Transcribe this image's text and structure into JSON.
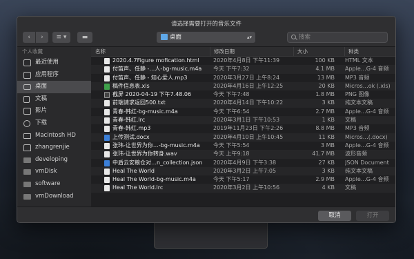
{
  "dialog": {
    "title": "请选择需要打开的音乐文件",
    "location": "桌面",
    "search_placeholder": "搜索"
  },
  "toolbar": {
    "back_glyph": "‹",
    "forward_glyph": "›",
    "view_glyph": "≡ ▾",
    "new_folder_glyph": "▬",
    "location_chevron": "▴▾"
  },
  "sidebar": {
    "heading": "个人收藏",
    "items": [
      {
        "label": "最近使用",
        "icon": "recent-icon"
      },
      {
        "label": "应用程序",
        "icon": "applications-icon"
      },
      {
        "label": "桌面",
        "icon": "desktop-icon"
      },
      {
        "label": "文稿",
        "icon": "documents-icon"
      },
      {
        "label": "影片",
        "icon": "movies-icon"
      },
      {
        "label": "下载",
        "icon": "downloads-icon"
      },
      {
        "label": "Macintosh HD",
        "icon": "hard-drive-icon"
      },
      {
        "label": "zhangrenjie",
        "icon": "home-icon"
      },
      {
        "label": "developing",
        "icon": "folder-icon"
      },
      {
        "label": "vmDisk",
        "icon": "folder-icon"
      },
      {
        "label": "software",
        "icon": "folder-icon"
      },
      {
        "label": "vmDownload",
        "icon": "folder-icon"
      }
    ]
  },
  "columns": {
    "name": "名称",
    "date": "修改日期",
    "size": "大小",
    "kind": "种类"
  },
  "files": [
    {
      "name": "2020.4.7Figure mofication.html",
      "date": "2020年4月8日 下午11:39",
      "size": "100 KB",
      "kind": "HTML 文本",
      "icon": "html-file-icon"
    },
    {
      "name": "付笛声、任静 -…人-bg-music.m4a",
      "date": "今天 下午7:32",
      "size": "4.1 MB",
      "kind": "Apple…G-4 音频",
      "icon": "audio-file-icon"
    },
    {
      "name": "付笛声、任静 - 知心爱人.mp3",
      "date": "2020年3月27日 上午8:24",
      "size": "13 MB",
      "kind": "MP3 音频",
      "icon": "audio-file-icon"
    },
    {
      "name": "稿件信息表.xls",
      "date": "2020年4月16日 上午12:25",
      "size": "20 KB",
      "kind": "Micros…ok (.xls)",
      "icon": "excel-file-icon"
    },
    {
      "name": "截屏 2020-04-19 下午7.48.06",
      "date": "今天 下午7:48",
      "size": "1.8 MB",
      "kind": "PNG 图像",
      "icon": "image-file-icon"
    },
    {
      "name": "前端请求返回500.txt",
      "date": "2020年4月14日 下午10:22",
      "size": "3 KB",
      "kind": "纯文本文稿",
      "icon": "text-file-icon"
    },
    {
      "name": "青春-韩红-bg-music.m4a",
      "date": "今天 下午6:54",
      "size": "2.7 MB",
      "kind": "Apple…G-4 音频",
      "icon": "audio-file-icon"
    },
    {
      "name": "青春-韩红.lrc",
      "date": "2020年3月1日 下午10:53",
      "size": "1 KB",
      "kind": "文稿",
      "icon": "lrc-file-icon"
    },
    {
      "name": "青春-韩红.mp3",
      "date": "2019年11月23日 下午2:26",
      "size": "8.8 MB",
      "kind": "MP3 音频",
      "icon": "audio-file-icon"
    },
    {
      "name": "上传测试.docx",
      "date": "2020年4月10日 上午10:45",
      "size": "11 KB",
      "kind": "Micros…(.docx)",
      "icon": "word-file-icon"
    },
    {
      "name": "张玮-让世界为你…-bg-music.m4a",
      "date": "今天 下午5:54",
      "size": "3 MB",
      "kind": "Apple…G-4 音频",
      "icon": "audio-file-icon"
    },
    {
      "name": "张玮-让世界为你转身.wav",
      "date": "今天 上午9:18",
      "size": "41.7 MB",
      "kind": "波形音频",
      "icon": "audio-file-icon"
    },
    {
      "name": "中盾云安粮仓对…n_collection.json",
      "date": "2020年4月9日 下午3:38",
      "size": "27 KB",
      "kind": "JSON Document",
      "icon": "json-file-icon"
    },
    {
      "name": "Heal The World",
      "date": "2020年3月2日 上午7:05",
      "size": "3 KB",
      "kind": "纯文本文稿",
      "icon": "text-file-icon"
    },
    {
      "name": "Heal The World-bg-music.m4a",
      "date": "今天 下午5:17",
      "size": "2.9 MB",
      "kind": "Apple…G-4 音频",
      "icon": "audio-file-icon"
    },
    {
      "name": "Heal The World.lrc",
      "date": "2020年3月2日 上午10:56",
      "size": "4 KB",
      "kind": "文稿",
      "icon": "lrc-file-icon"
    }
  ],
  "footer": {
    "cancel_label": "取消",
    "open_label": "打开"
  },
  "colors": {
    "dialog_bg": "#2b2b2d",
    "list_bg": "#1f1f21",
    "sidebar_selected": "#4a4a4d",
    "folder_blue": "#5fa8e8",
    "word_blue": "#3b7fd8",
    "excel_green": "#3fa14b"
  }
}
